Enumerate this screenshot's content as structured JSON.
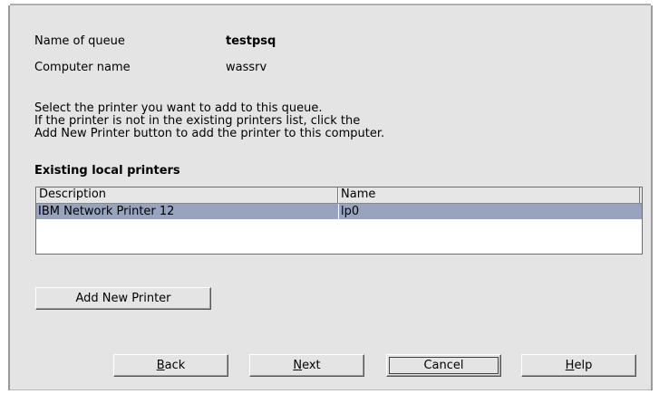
{
  "queue": {
    "name_label": "Name of queue",
    "name_value": "testpsq"
  },
  "computer": {
    "name_label": "Computer name",
    "name_value": "wassrv"
  },
  "instructions": [
    "Select the printer you want to add to this queue.",
    "If the printer is not in the existing printers list, click the",
    "Add New Printer button to add the printer to this computer."
  ],
  "printers": {
    "heading": "Existing local printers",
    "columns": [
      "Description",
      "Name"
    ],
    "rows": [
      {
        "description": "IBM Network Printer 12",
        "name": "lp0",
        "selected": true
      }
    ]
  },
  "add_button": "Add New Printer",
  "buttons": {
    "back": {
      "label": "Back",
      "mnemonic": "B",
      "rest": "ack"
    },
    "next": {
      "label": "Next",
      "mnemonic": "N",
      "rest": "ext"
    },
    "cancel": {
      "label": "Cancel"
    },
    "help": {
      "label": "Help",
      "mnemonic": "H",
      "rest": "elp"
    }
  },
  "colors": {
    "panel": "#e4e4e4",
    "selection": "#98a4bf"
  }
}
